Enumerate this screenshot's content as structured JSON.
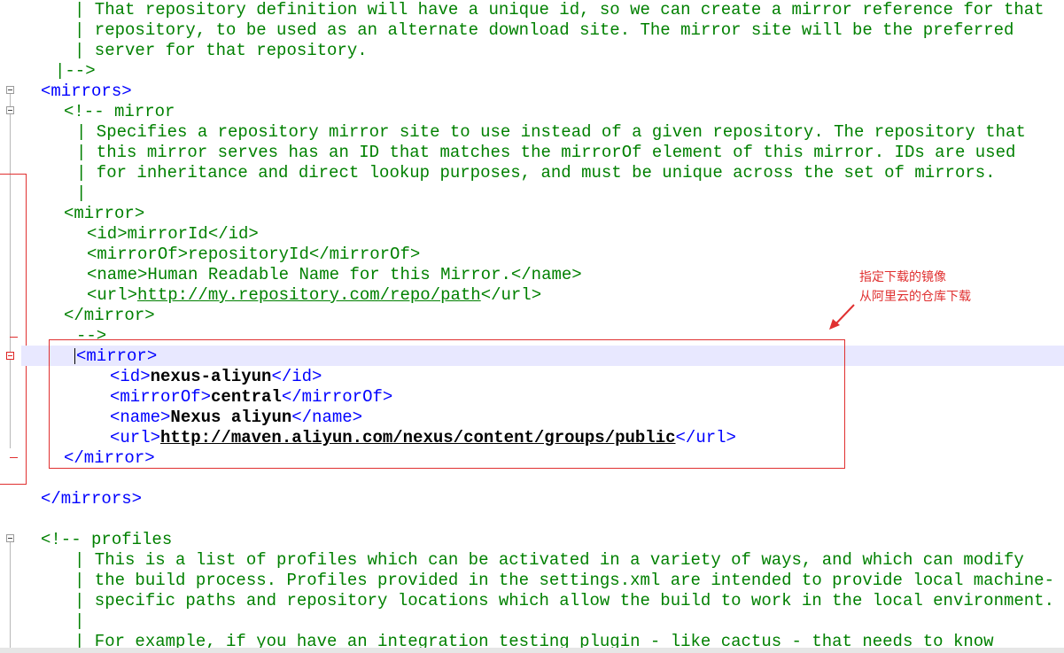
{
  "editor": {
    "lines": [
      {
        "segs": [
          {
            "t": "| That repository definition will have a unique id, so we can create a mirror reference for that",
            "c": "comment"
          }
        ]
      },
      {
        "segs": [
          {
            "t": "| repository, to be used as an alternate download site. The mirror site will be the preferred",
            "c": "comment"
          }
        ]
      },
      {
        "segs": [
          {
            "t": "| server for that repository.",
            "c": "comment"
          }
        ]
      },
      {
        "segs": [
          {
            "t": "|-->",
            "c": "comment"
          }
        ]
      },
      {
        "segs": [
          {
            "t": "<mirrors>",
            "c": "tag"
          }
        ]
      },
      {
        "segs": [
          {
            "t": "<!-- mirror",
            "c": "comment"
          }
        ]
      },
      {
        "segs": [
          {
            "t": "| Specifies a repository mirror site to use instead of a given repository. The repository that",
            "c": "comment"
          }
        ]
      },
      {
        "segs": [
          {
            "t": "| this mirror serves has an ID that matches the mirrorOf element of this mirror. IDs are used",
            "c": "comment"
          }
        ]
      },
      {
        "segs": [
          {
            "t": "| for inheritance and direct lookup purposes, and must be unique across the set of mirrors.",
            "c": "comment"
          }
        ]
      },
      {
        "segs": [
          {
            "t": "|",
            "c": "comment"
          }
        ]
      },
      {
        "segs": [
          {
            "t": "<mirror>",
            "c": "comment"
          }
        ]
      },
      {
        "segs": [
          {
            "t": "<id>mirrorId</id>",
            "c": "comment"
          }
        ]
      },
      {
        "segs": [
          {
            "t": "<mirrorOf>repositoryId</mirrorOf>",
            "c": "comment"
          }
        ]
      },
      {
        "segs": [
          {
            "t": "<name>Human Readable Name for this Mirror.</name>",
            "c": "comment"
          }
        ]
      },
      {
        "segs": [
          {
            "t": "<url>",
            "c": "comment"
          },
          {
            "t": "http://my.repository.com/repo/path",
            "c": "comment",
            "u": true
          },
          {
            "t": "</url>",
            "c": "comment"
          }
        ]
      },
      {
        "segs": [
          {
            "t": "</mirror>",
            "c": "comment"
          }
        ]
      },
      {
        "segs": [
          {
            "t": "-->",
            "c": "comment"
          }
        ]
      },
      {
        "segs": [
          {
            "t": "<mirror>",
            "c": "tag"
          }
        ]
      },
      {
        "segs": [
          {
            "t": "<id>",
            "c": "tag"
          },
          {
            "t": "nexus-aliyun",
            "c": "text",
            "b": true
          },
          {
            "t": "</id>",
            "c": "tag"
          }
        ]
      },
      {
        "segs": [
          {
            "t": "<mirrorOf>",
            "c": "tag"
          },
          {
            "t": "central",
            "c": "text",
            "b": true
          },
          {
            "t": "</mirrorOf>",
            "c": "tag"
          }
        ]
      },
      {
        "segs": [
          {
            "t": "<name>",
            "c": "tag"
          },
          {
            "t": "Nexus aliyun",
            "c": "text",
            "b": true
          },
          {
            "t": "</name>",
            "c": "tag"
          }
        ]
      },
      {
        "segs": [
          {
            "t": "<url>",
            "c": "tag"
          },
          {
            "t": "http://maven.aliyun.com/nexus/content/groups/public",
            "c": "text",
            "b": true,
            "u": true
          },
          {
            "t": "</url>",
            "c": "tag"
          }
        ]
      },
      {
        "segs": [
          {
            "t": "</mirror>",
            "c": "tag"
          }
        ]
      },
      {
        "segs": [
          {
            "t": "",
            "c": "text"
          }
        ]
      },
      {
        "segs": [
          {
            "t": "</mirrors>",
            "c": "tag"
          }
        ]
      },
      {
        "segs": [
          {
            "t": "",
            "c": "text"
          }
        ]
      },
      {
        "segs": [
          {
            "t": "<!-- profiles",
            "c": "comment"
          }
        ]
      },
      {
        "segs": [
          {
            "t": "| This is a list of profiles which can be activated in a variety of ways, and which can modify",
            "c": "comment"
          }
        ]
      },
      {
        "segs": [
          {
            "t": "| the build process. Profiles provided in the settings.xml are intended to provide local machine-",
            "c": "comment"
          }
        ]
      },
      {
        "segs": [
          {
            "t": "| specific paths and repository locations which allow the build to work in the local environment.",
            "c": "comment"
          }
        ]
      },
      {
        "segs": [
          {
            "t": "|",
            "c": "comment"
          }
        ]
      },
      {
        "segs": [
          {
            "t": "| For example, if you have an integration testing plugin - like cactus - that needs to know",
            "c": "comment"
          }
        ]
      }
    ]
  },
  "annotation": {
    "line1": "指定下载的镜像",
    "line2": "从阿里云的仓库下载"
  },
  "colors": {
    "tag": "#0000ff",
    "comment": "#008000",
    "text": "#000000",
    "annotation": "#e03030",
    "current_line": "#e8e8ff"
  }
}
